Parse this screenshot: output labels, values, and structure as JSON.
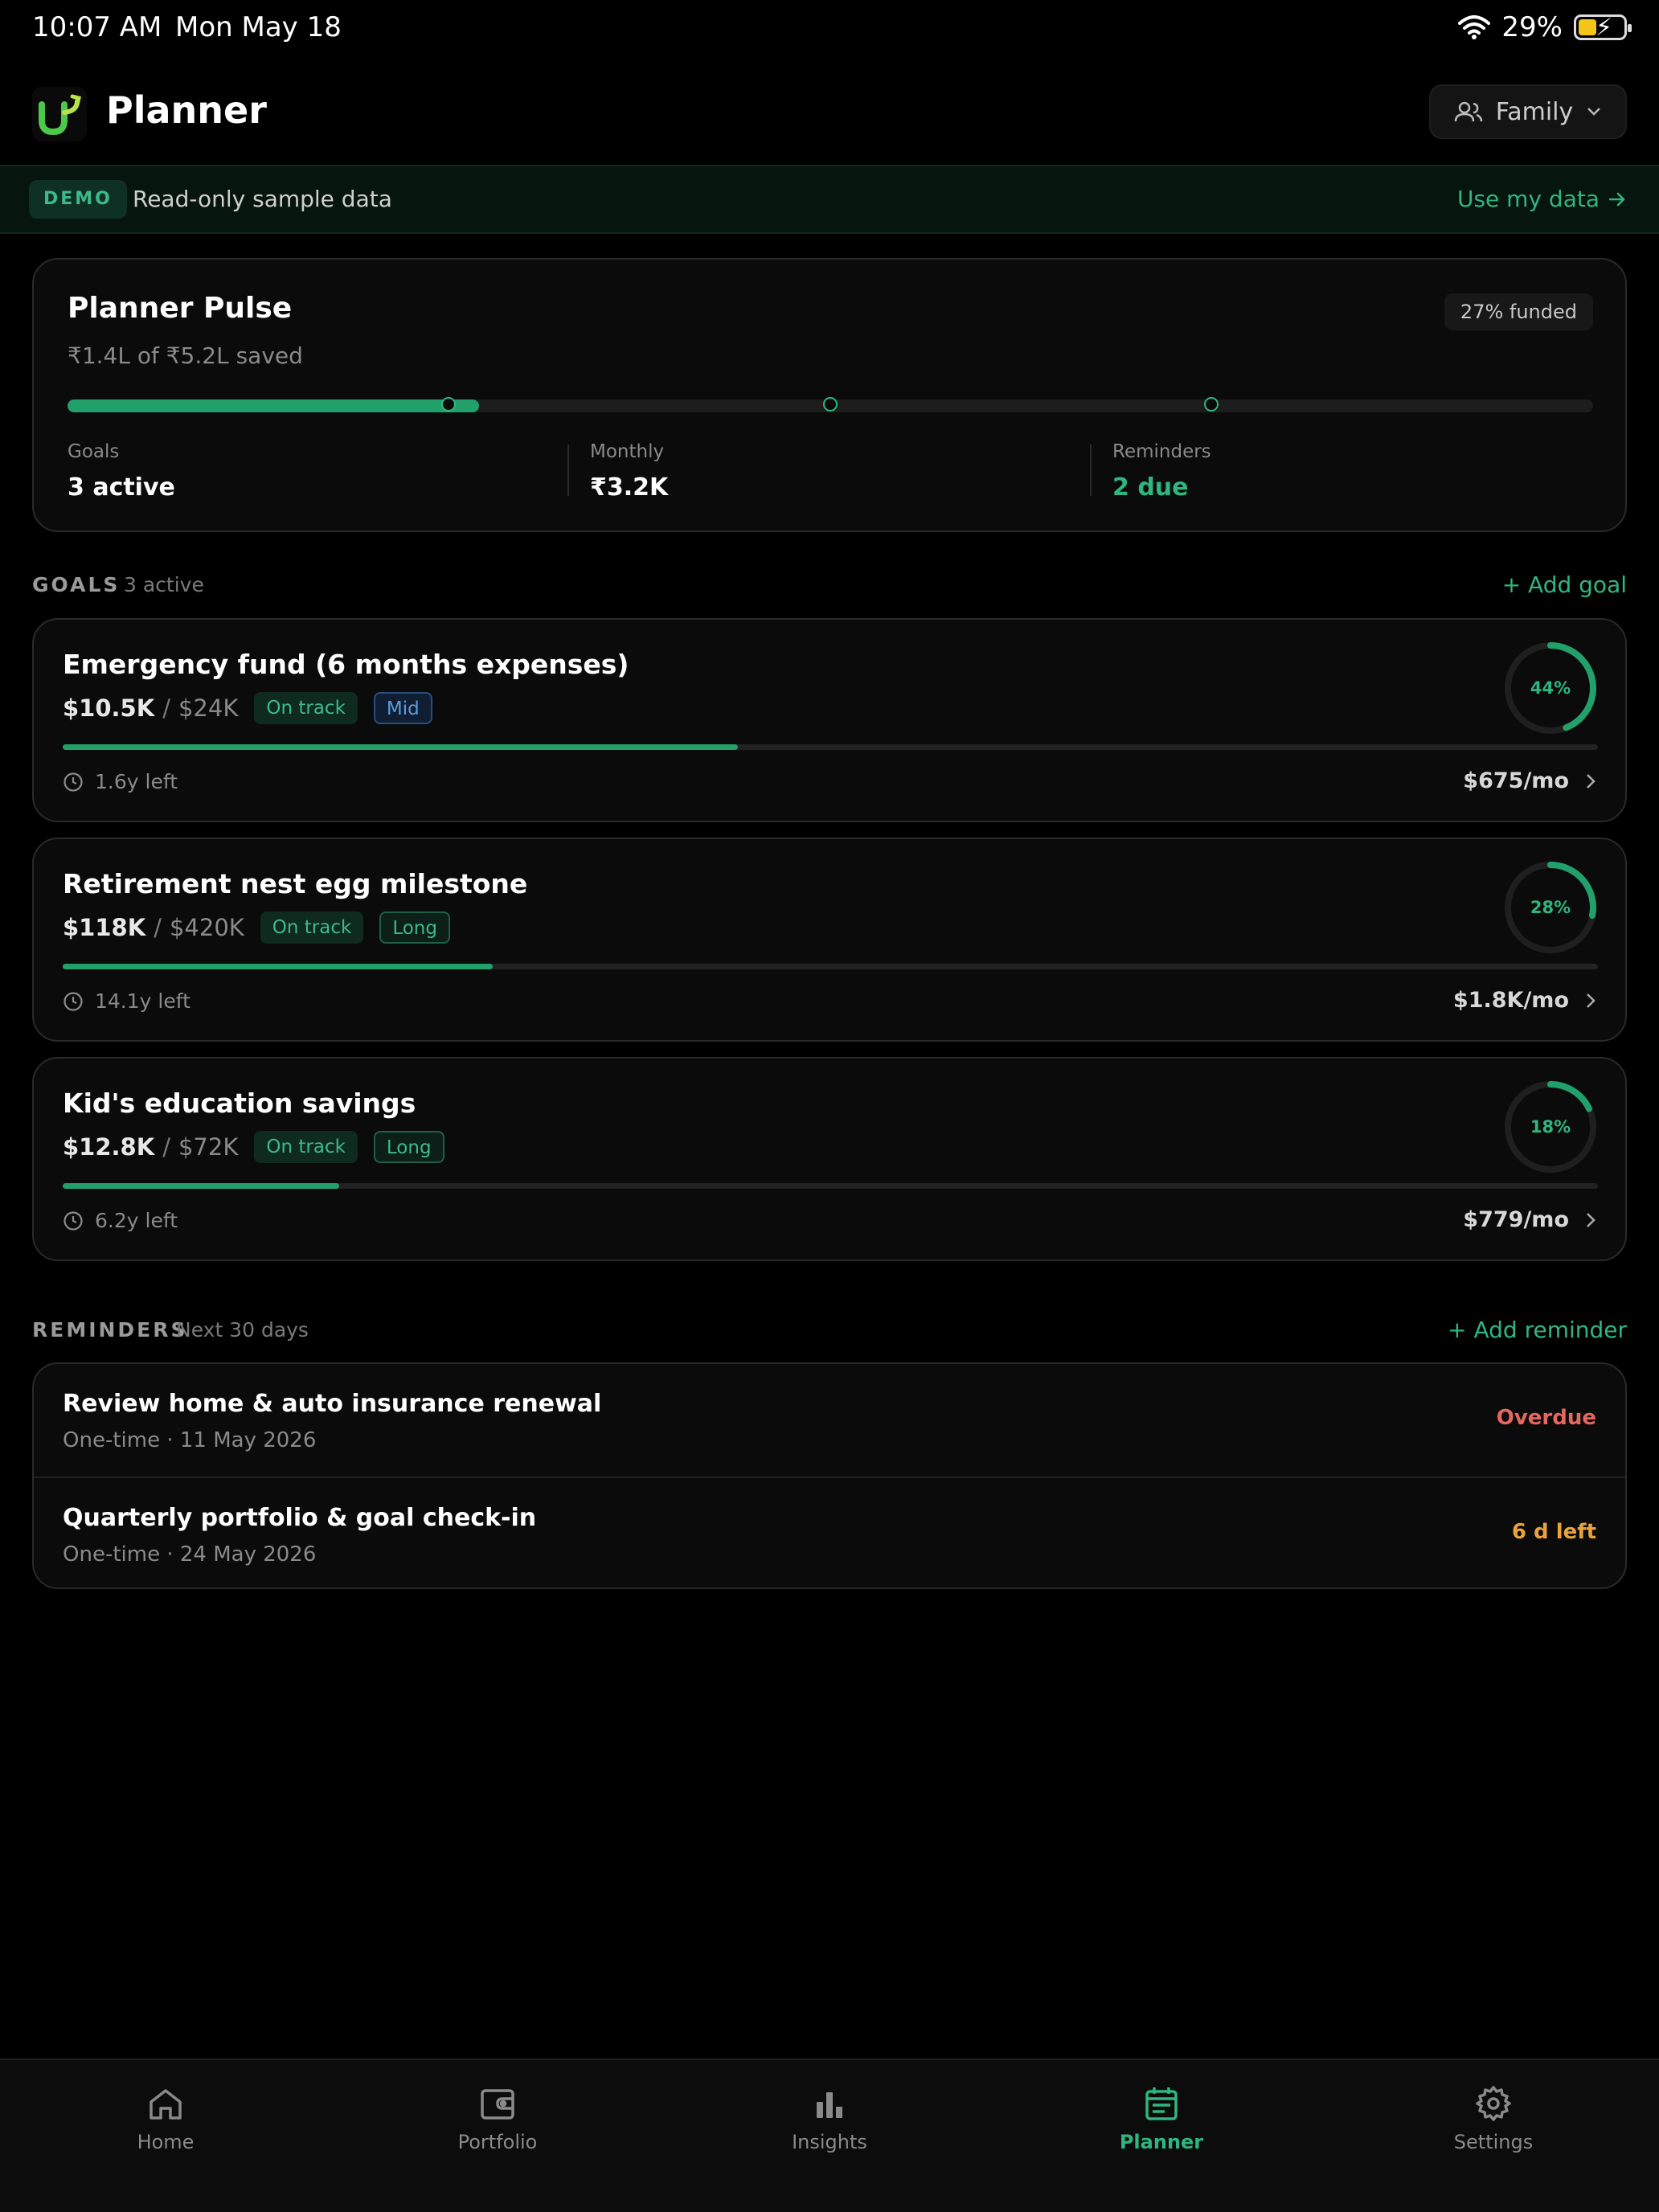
{
  "status_bar": {
    "time": "10:07 AM",
    "date": "Mon May 18",
    "battery": "29%"
  },
  "header": {
    "title": "Planner",
    "profile": "Family"
  },
  "demo": {
    "badge": "DEMO",
    "text": "Read-only sample data",
    "action": "Use my data"
  },
  "pulse": {
    "title": "Planner Pulse",
    "subtitle": "₹1.4L of ₹5.2L saved",
    "funded_badge": "27% funded",
    "progress_fraction": 0.27,
    "stats": [
      {
        "label": "Goals",
        "value": "3 active"
      },
      {
        "label": "Monthly",
        "value": "₹3.2K"
      },
      {
        "label": "Reminders",
        "value": "2 due"
      }
    ]
  },
  "goals_section": {
    "title": "GOALS",
    "subtitle": "3 active",
    "action": "+ Add goal"
  },
  "goals": [
    {
      "title": "Emergency fund (6 months expenses)",
      "saved": "$10.5K",
      "sep": "/",
      "target": "$24K",
      "status": "On track",
      "horizon": "Mid",
      "progress": 44,
      "percent_label": "44%",
      "time_left": "1.6y left",
      "monthly": "$675/mo"
    },
    {
      "title": "Retirement nest egg milestone",
      "saved": "$118K",
      "sep": "/",
      "target": "$420K",
      "status": "On track",
      "horizon": "Long",
      "progress": 28,
      "percent_label": "28%",
      "time_left": "14.1y left",
      "monthly": "$1.8K/mo"
    },
    {
      "title": "Kid's education savings",
      "saved": "$12.8K",
      "sep": "/",
      "target": "$72K",
      "status": "On track",
      "horizon": "Long",
      "progress": 18,
      "percent_label": "18%",
      "time_left": "6.2y left",
      "monthly": "$779/mo"
    }
  ],
  "reminders_section": {
    "title": "REMINDERS",
    "subtitle": "Next 30 days",
    "action": "+ Add reminder"
  },
  "reminders": [
    {
      "title": "Review home & auto insurance renewal",
      "subtitle": "One-time · 11 May 2026",
      "status": "Overdue",
      "status_color": "#e5675f"
    },
    {
      "title": "Quarterly portfolio & goal check-in",
      "subtitle": "One-time · 24 May 2026",
      "status": "6 d left",
      "status_color": "#e8a33d"
    }
  ],
  "nav": [
    {
      "label": "Home",
      "icon": "home-icon"
    },
    {
      "label": "Portfolio",
      "icon": "wallet-icon"
    },
    {
      "label": "Insights",
      "icon": "bar-chart-icon"
    },
    {
      "label": "Planner",
      "icon": "calendar-icon",
      "active": true
    },
    {
      "label": "Settings",
      "icon": "gear-icon"
    }
  ],
  "colors": {
    "accent": "#2fb67f",
    "overdue": "#e5675f",
    "warning": "#e8a33d",
    "mid": "#5b9bdc"
  }
}
